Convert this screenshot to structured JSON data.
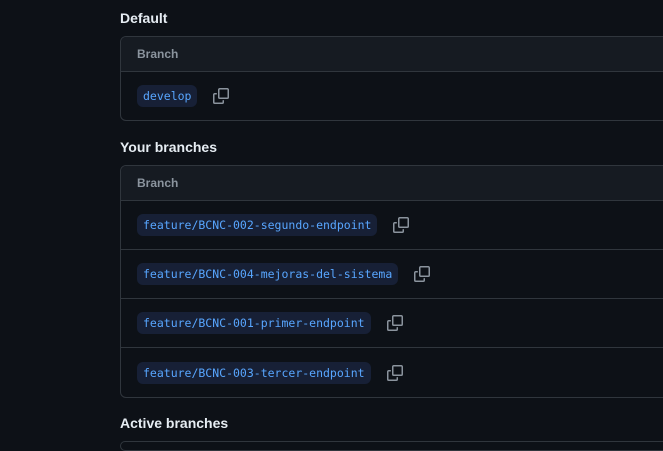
{
  "sections": {
    "default": {
      "title": "Default",
      "header": "Branch",
      "branches": [
        "develop"
      ]
    },
    "yours": {
      "title": "Your branches",
      "header": "Branch",
      "branches": [
        "feature/BCNC-002-segundo-endpoint",
        "feature/BCNC-004-mejoras-del-sistema",
        "feature/BCNC-001-primer-endpoint",
        "feature/BCNC-003-tercer-endpoint"
      ]
    },
    "active": {
      "title": "Active branches"
    }
  },
  "icons": {
    "copy": "copy-icon"
  },
  "colors": {
    "background": "#0d1117",
    "border": "#30363d",
    "header_bg": "#161b22",
    "branch_text": "#58a6ff",
    "branch_bg": "#172036",
    "muted": "#8b949e"
  }
}
